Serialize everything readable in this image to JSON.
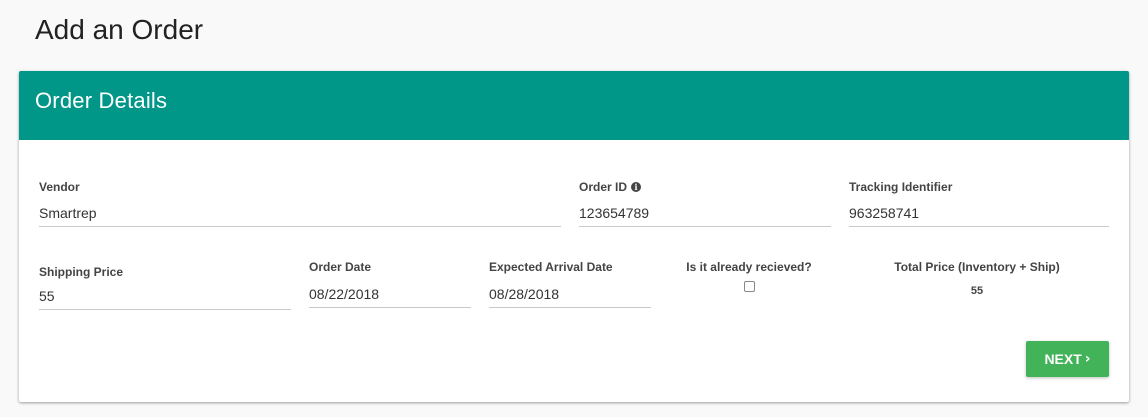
{
  "page": {
    "title": "Add an Order"
  },
  "card": {
    "title": "Order Details",
    "header_color": "#009688"
  },
  "fields": {
    "vendor": {
      "label": "Vendor",
      "value": "Smartrep"
    },
    "order_id": {
      "label": "Order ID",
      "value": "123654789",
      "icon": "info-icon"
    },
    "tracking": {
      "label": "Tracking Identifier",
      "value": "963258741"
    },
    "shipping_price": {
      "label": "Shipping Price",
      "value": "55"
    },
    "order_date": {
      "label": "Order Date",
      "value": "08/22/2018"
    },
    "arrival_date": {
      "label": "Expected Arrival Date",
      "value": "08/28/2018"
    },
    "received": {
      "label": "Is it already recieved?",
      "checked": false
    },
    "total": {
      "label": "Total Price (Inventory + Ship)",
      "value": "55"
    }
  },
  "actions": {
    "next_label": "NEXT",
    "next_icon": "chevron-right-icon",
    "next_color": "#43b35a"
  }
}
